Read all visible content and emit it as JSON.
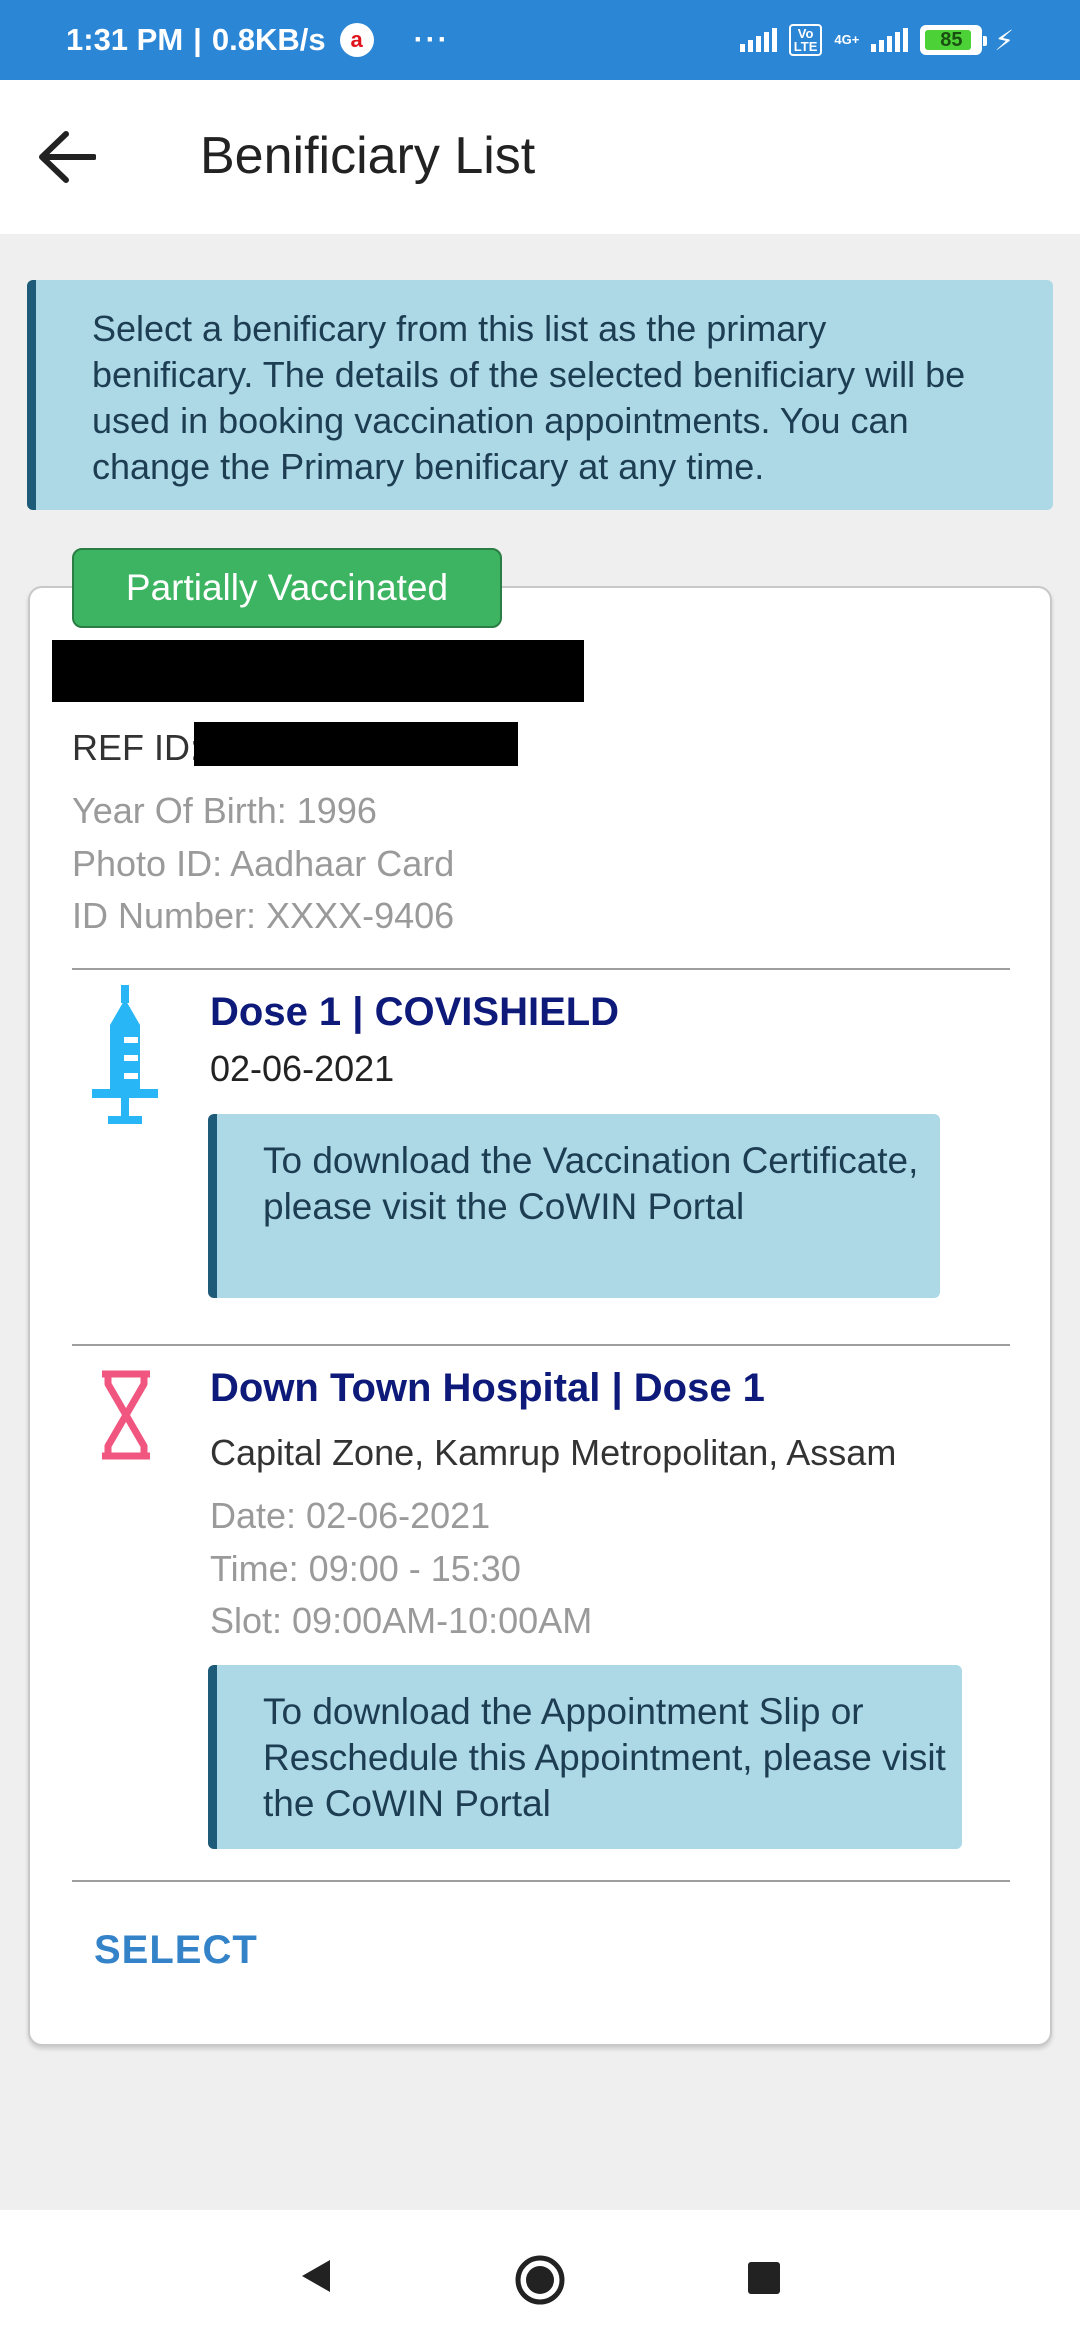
{
  "status_bar": {
    "time": "1:31 PM",
    "separator": "|",
    "speed": "0.8KB/s",
    "dots": "···",
    "volte_label": "Vo\nLTE",
    "network_label": "4G+",
    "battery": "85",
    "battery_level": 0.85
  },
  "app_bar": {
    "title": "Benificiary List",
    "back_icon": "arrow-back-icon"
  },
  "info_banner": {
    "text": "Select a benificary from this list as the primary benificary. The details of the selected benificiary will be used in booking vaccination appointments. You can change the Primary benificary at any time."
  },
  "card": {
    "status_badge": "Partially Vaccinated",
    "ref_label": "REF ID:",
    "year_of_birth": "Year Of Birth: 1996",
    "photo_id": "Photo ID: Aadhaar Card",
    "id_number": "ID Number: XXXX-9406",
    "dose": {
      "icon": "syringe-icon",
      "title": "Dose 1 | COVISHIELD",
      "date": "02-06-2021",
      "note": "To download the Vaccination Certificate, please visit the CoWIN Portal"
    },
    "appointment": {
      "icon": "hourglass-icon",
      "title": "Down Town Hospital | Dose 1",
      "address": "Capital Zone, Kamrup Metropolitan, Assam",
      "date": "Date: 02-06-2021",
      "time": "Time: 09:00 - 15:30",
      "slot": "Slot: 09:00AM-10:00AM",
      "note": "To download the Appointment Slip or Reschedule this Appointment, please visit the CoWIN Portal"
    },
    "select_label": "SELECT"
  },
  "colors": {
    "status_bar": "#2b86d6",
    "badge": "#3db462",
    "banner_bg": "#add8e6",
    "banner_border": "#1d5b78",
    "title_navy": "#0d1a7a",
    "syringe": "#29b6f6",
    "hourglass": "#f0567f",
    "select": "#3483c8"
  },
  "nav_bar": {
    "back_icon": "nav-back-icon",
    "home_icon": "nav-home-icon",
    "recents_icon": "nav-recents-icon"
  }
}
